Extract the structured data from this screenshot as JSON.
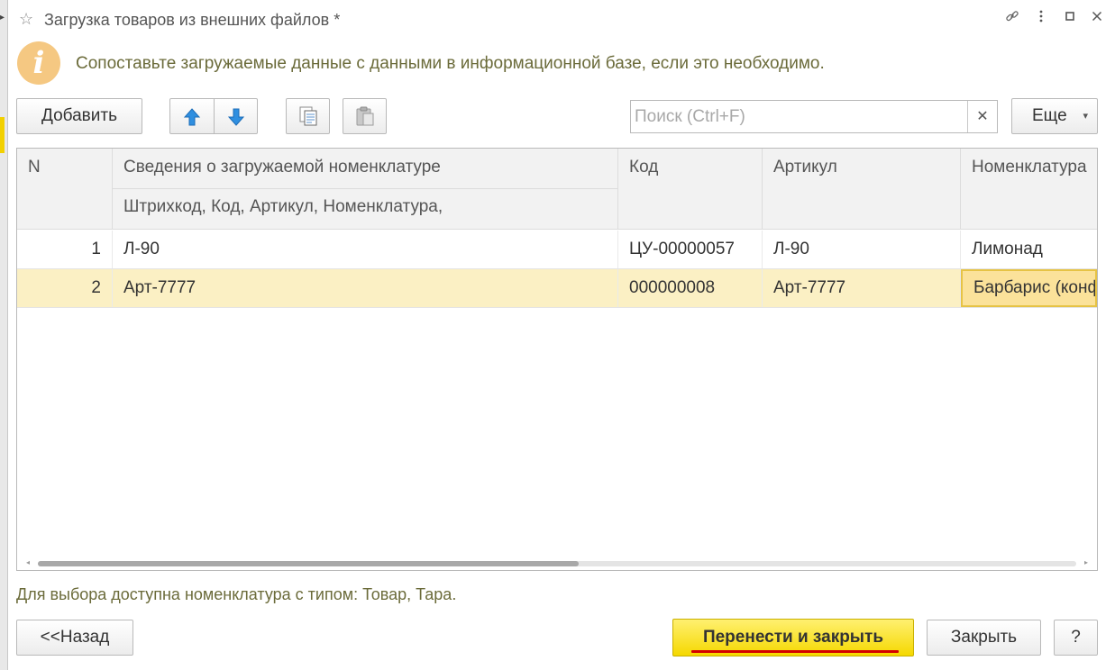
{
  "window": {
    "title": "Загрузка товаров из внешних файлов *"
  },
  "info": {
    "message": "Сопоставьте загружаемые данные с данными в информационной базе, если это необходимо."
  },
  "toolbar": {
    "add_label": "Добавить",
    "search_placeholder": "Поиск (Ctrl+F)",
    "more_label": "Еще"
  },
  "table": {
    "headers": {
      "n": "N",
      "info": "Сведения о загружаемой номенклатуре",
      "info_sub": "Штрихкод, Код, Артикул, Номенклатура,",
      "code": "Код",
      "article": "Артикул",
      "nomenclature": "Номенклатура"
    },
    "rows": [
      {
        "n": "1",
        "info": "Л-90",
        "code": "ЦУ-00000057",
        "article": "Л-90",
        "nomenclature": "Лимонад"
      },
      {
        "n": "2",
        "info": "Арт-7777",
        "code": "000000008",
        "article": "Арт-7777",
        "nomenclature": "Барбарис (конфета)"
      }
    ]
  },
  "hint": "Для выбора доступна номенклатура с типом: Товар, Тара.",
  "footer": {
    "back_label": "<<Назад",
    "transfer_label": "Перенести и закрыть",
    "close_label": "Закрыть",
    "help_label": "?"
  },
  "colors": {
    "primary_button": "#f5d800",
    "selected_row": "#fbf0c4",
    "hint_text": "#6b6b3a",
    "arrow_blue": "#2f8fe0"
  },
  "icons": {
    "favorite": "star-icon",
    "link": "link-icon",
    "menu": "more-vertical-icon",
    "maximize": "maximize-icon",
    "close": "close-icon",
    "info": "info-icon",
    "move_up": "arrow-up-icon",
    "move_down": "arrow-down-icon",
    "copy": "copy-icon",
    "paste": "paste-icon",
    "clear": "clear-icon",
    "dropdown": "chevron-down-icon"
  }
}
